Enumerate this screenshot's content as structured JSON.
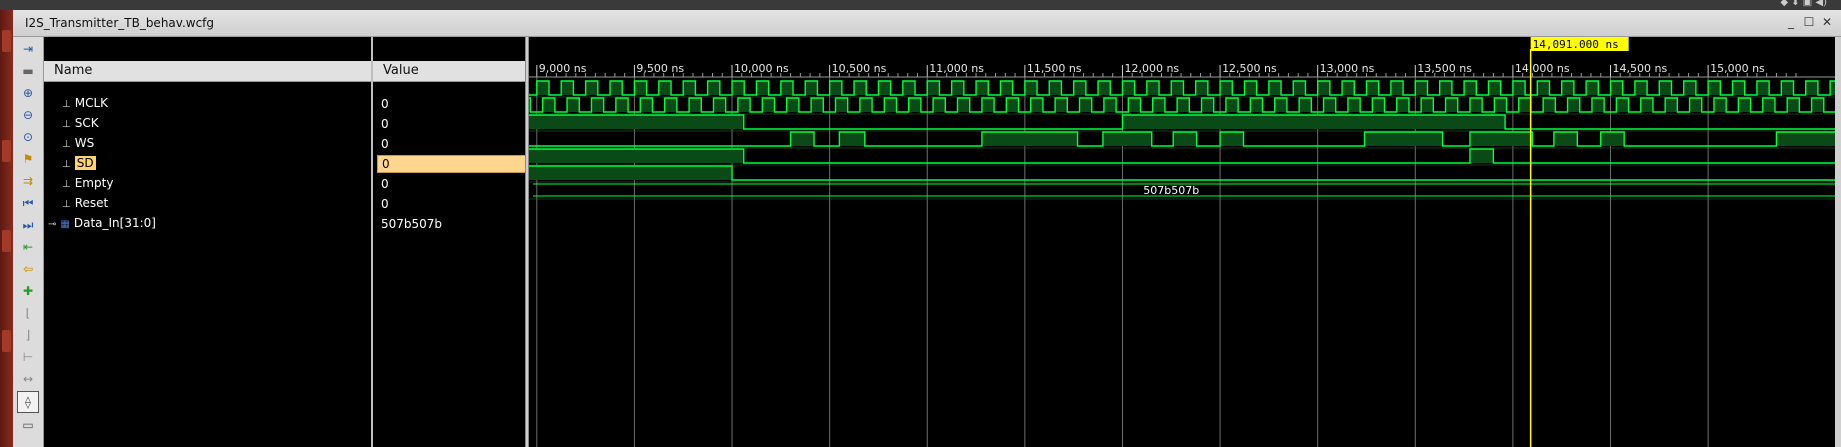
{
  "window": {
    "title": "I2S_Transmitter_TB_behav.wcfg"
  },
  "columns": {
    "name": "Name",
    "value": "Value"
  },
  "signals": [
    {
      "name": "MCLK",
      "value": "0",
      "kind": "bit",
      "selected": false
    },
    {
      "name": "SCK",
      "value": "0",
      "kind": "bit",
      "selected": false
    },
    {
      "name": "WS",
      "value": "0",
      "kind": "bit",
      "selected": false
    },
    {
      "name": "SD",
      "value": "0",
      "kind": "bit",
      "selected": true
    },
    {
      "name": "Empty",
      "value": "0",
      "kind": "bit",
      "selected": false
    },
    {
      "name": "Reset",
      "value": "0",
      "kind": "bit",
      "selected": false
    },
    {
      "name": "Data_In[31:0]",
      "value": "507b507b",
      "kind": "bus",
      "selected": false
    }
  ],
  "timeline": {
    "unit": "ns",
    "view_start_ns": 8960,
    "view_end_ns": 15650,
    "ticks": [
      "9,000 ns",
      "9,500 ns",
      "10,000 ns",
      "10,500 ns",
      "11,000 ns",
      "11,500 ns",
      "12,000 ns",
      "12,500 ns",
      "13,000 ns",
      "13,500 ns",
      "14,000 ns",
      "14,500 ns",
      "15,000 ns"
    ],
    "tick_values_ns": [
      9000,
      9500,
      10000,
      10500,
      11000,
      11500,
      12000,
      12500,
      13000,
      13500,
      14000,
      14500,
      15000
    ],
    "cursor_ns": 14091,
    "cursor_label": "14,091.000 ns"
  },
  "waves": {
    "MCLK_period_ns": 125,
    "SCK_period_ns": 125,
    "WS": [
      [
        8960,
        1
      ],
      [
        10060,
        0
      ],
      [
        12000,
        1
      ],
      [
        13960,
        0
      ]
    ],
    "SD": [
      [
        8960,
        0
      ],
      [
        10300,
        1
      ],
      [
        10420,
        0
      ],
      [
        10550,
        1
      ],
      [
        10680,
        0
      ],
      [
        11280,
        1
      ],
      [
        11770,
        0
      ],
      [
        11900,
        1
      ],
      [
        12150,
        0
      ],
      [
        12260,
        1
      ],
      [
        12380,
        0
      ],
      [
        12500,
        1
      ],
      [
        12620,
        0
      ],
      [
        13240,
        1
      ],
      [
        13640,
        0
      ],
      [
        13780,
        1
      ],
      [
        14100,
        0
      ],
      [
        14210,
        1
      ],
      [
        14330,
        0
      ],
      [
        14450,
        1
      ],
      [
        14570,
        0
      ],
      [
        15350,
        1
      ]
    ],
    "Empty": [
      [
        8960,
        1
      ],
      [
        10060,
        0
      ],
      [
        13780,
        1
      ],
      [
        13900,
        0
      ]
    ],
    "Reset": [
      [
        8960,
        1
      ],
      [
        10000,
        0
      ]
    ],
    "Data_In_label": "507b507b"
  },
  "colors": {
    "wave": "#00ff3c",
    "wave_fill": "#0a4a16",
    "grid": "#6e6e6e",
    "cursor": "#ffff00",
    "cursor_label_bg": "#ffff00",
    "selected_value_bg": "#ffd690"
  },
  "toolbar_icons": [
    "goto-icon",
    "save-icon",
    "zoom-in-icon",
    "zoom-out-icon",
    "zoom-fit-icon",
    "marker-icon",
    "goto-cursor-icon",
    "prev-edge-icon",
    "next-edge-icon",
    "add-marker-icon",
    "prev-marker-icon",
    "next-marker-icon",
    "swap-cursor-icon",
    "snap-icon",
    "mark-icon",
    "measure-icon",
    "cursor-toggle-icon",
    "bus-icon"
  ]
}
